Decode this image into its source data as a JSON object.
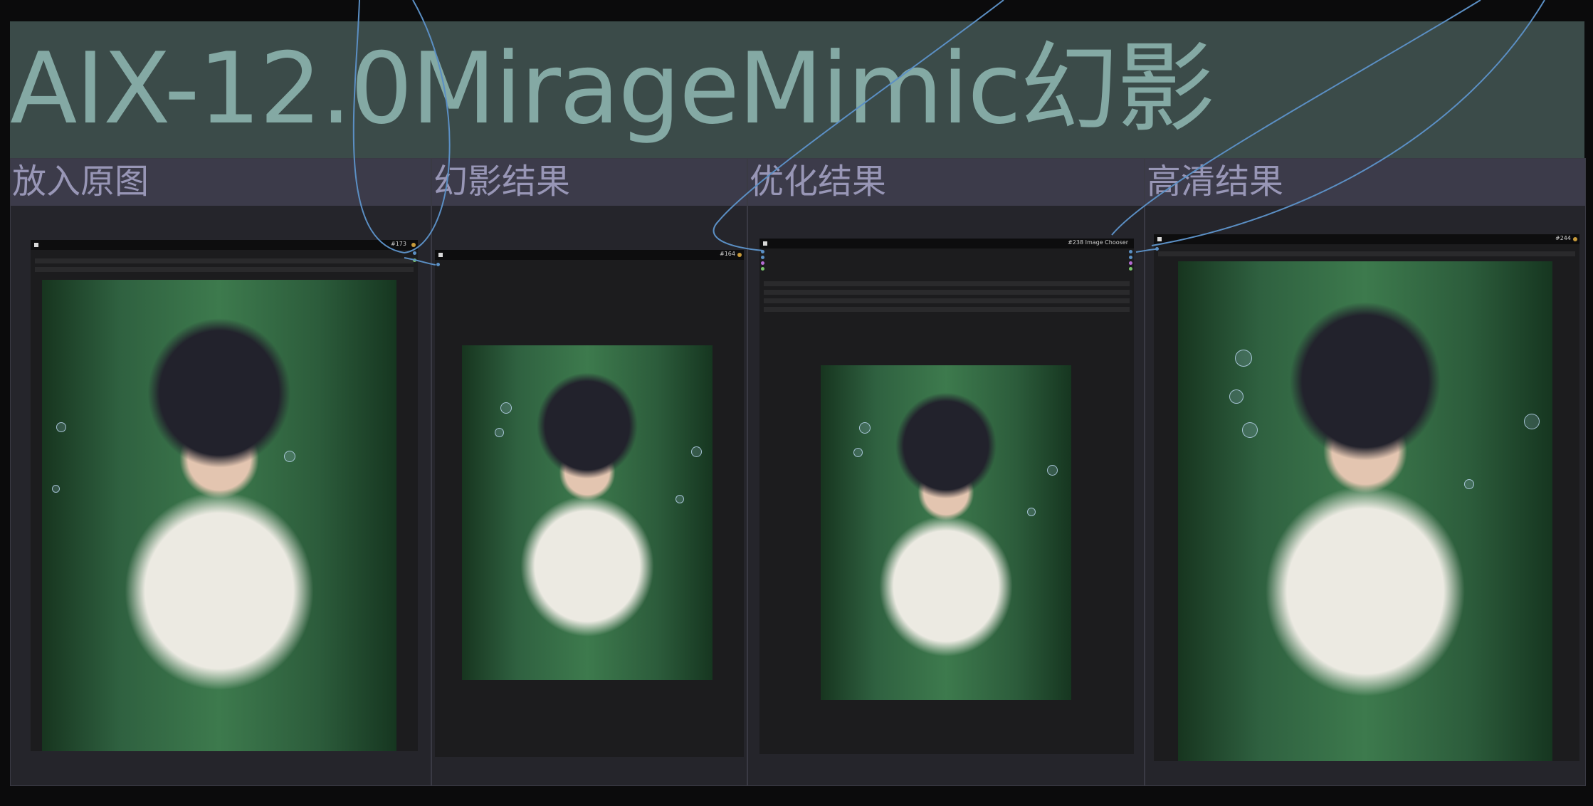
{
  "banner": {
    "title": "AIX-12.0MirageMimic幻影"
  },
  "groups": [
    {
      "title": "放入原图"
    },
    {
      "title": "幻影结果"
    },
    {
      "title": "优化结果"
    },
    {
      "title": "高清结果"
    }
  ],
  "nodes": {
    "source": {
      "id_label": "#173"
    },
    "mirage": {
      "id_label": "#164"
    },
    "optimize": {
      "id_label": "#238 Image Chooser"
    },
    "hd": {
      "id_label": "#244"
    }
  },
  "colors": {
    "banner_bg": "#3b4b49",
    "banner_text": "#84a9a4",
    "group_header": "#3c3b4a",
    "group_title": "#9896b6",
    "link": "#5b8fc4"
  },
  "icons": [
    "collapse-dot-icon",
    "node-status-dot-icon",
    "input-slot-icon",
    "output-slot-icon"
  ]
}
